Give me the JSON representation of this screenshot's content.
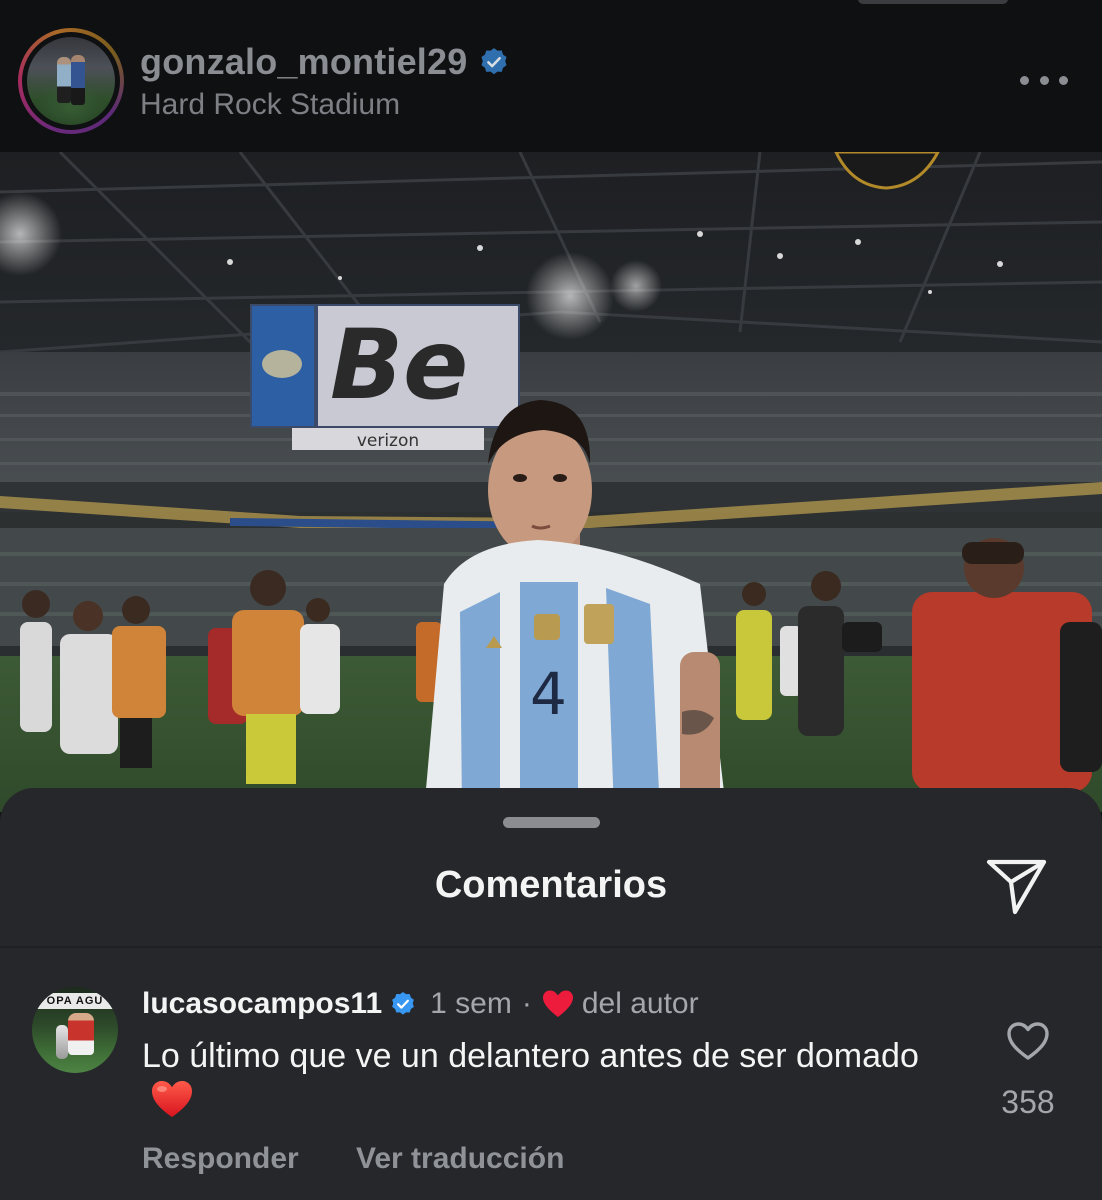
{
  "post": {
    "username": "gonzalo_montiel29",
    "location": "Hard Rock Stadium",
    "image": {
      "scoreboard_text": "Be",
      "sponsor_text": "verizon",
      "jersey_number": "4"
    }
  },
  "comments_sheet": {
    "title": "Comentarios",
    "comment": {
      "username": "lucasocampos11",
      "time": "1 sem",
      "separator": "·",
      "liked_by_author_label": "del autor",
      "text": "Lo último que ve un delantero antes de ser domado",
      "like_count": "358",
      "reply_label": "Responder",
      "translate_label": "Ver traducción"
    }
  },
  "colors": {
    "verified_blue": "#3897f0",
    "heart_red": "#ed1c3c"
  }
}
